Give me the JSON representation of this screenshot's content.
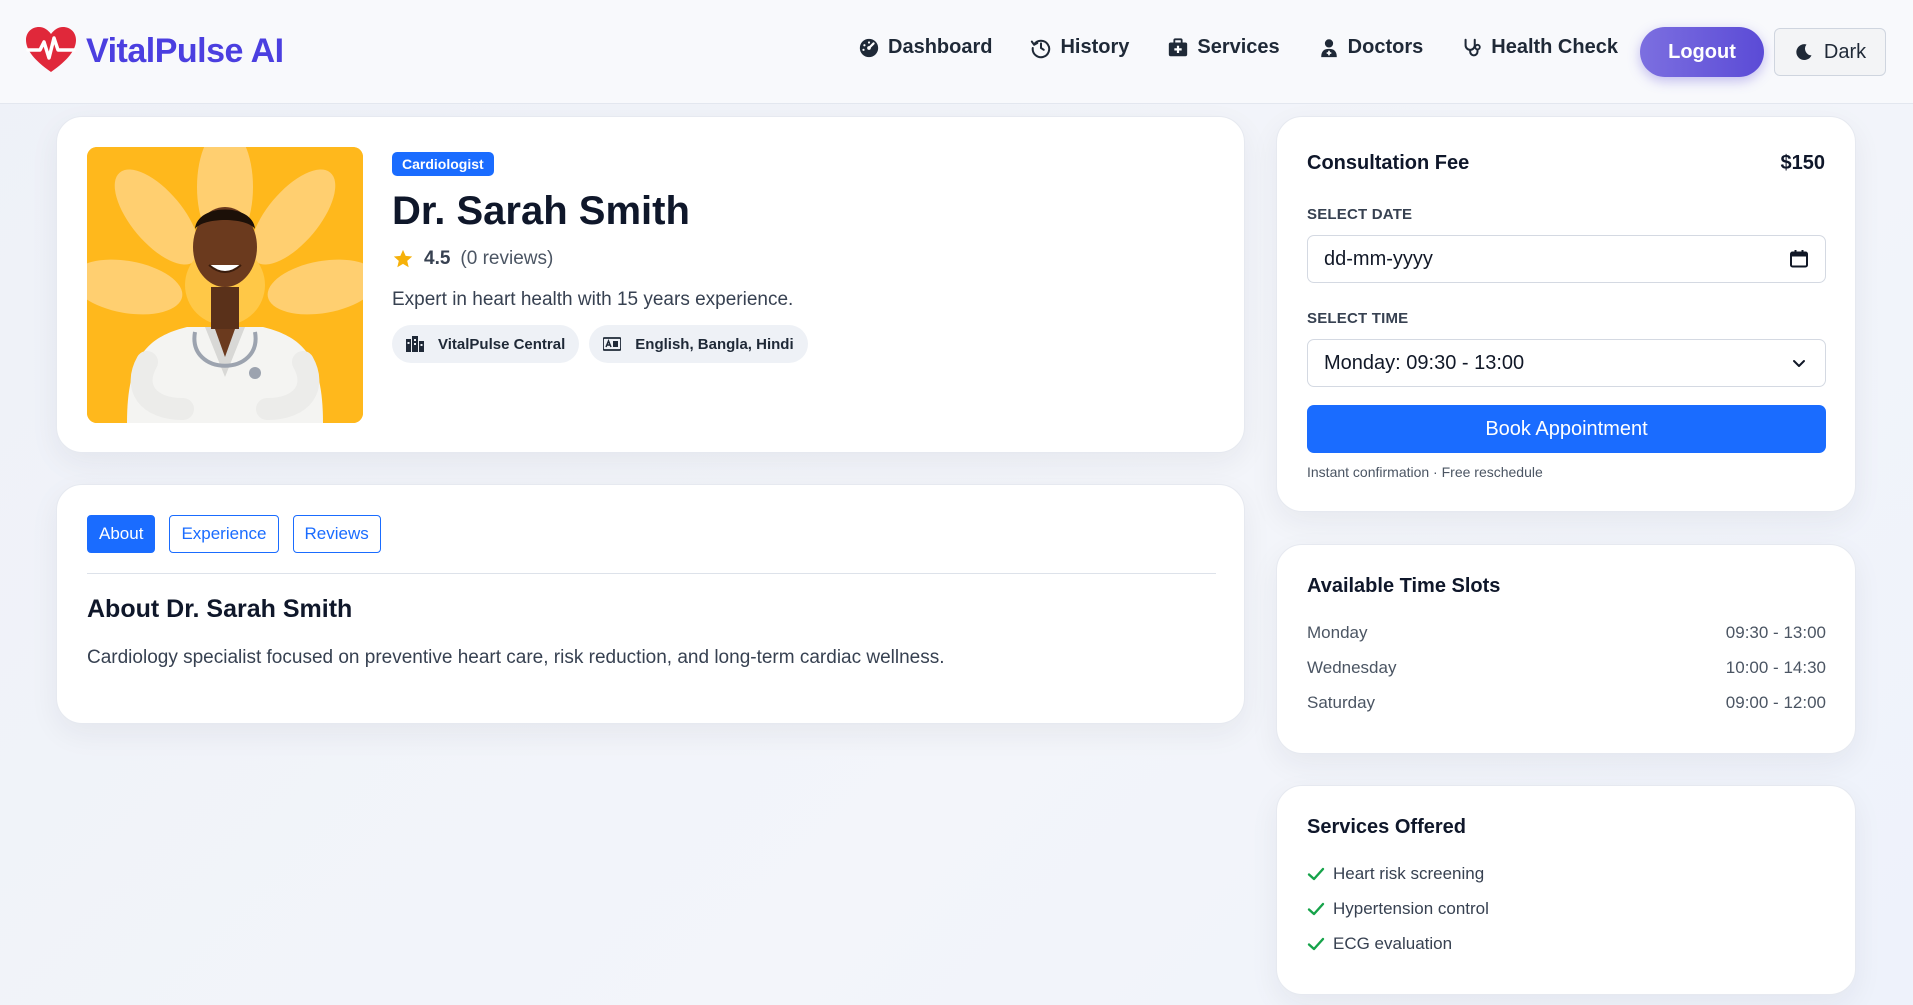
{
  "app": {
    "brand_name": "VitalPulse AI",
    "brand_color": "#4b3fe0",
    "accent": "#1a6cff"
  },
  "nav": {
    "items": [
      {
        "label": "Dashboard",
        "icon": "gauge-icon"
      },
      {
        "label": "History",
        "icon": "history-icon"
      },
      {
        "label": "Services",
        "icon": "briefcase-medical-icon"
      },
      {
        "label": "Doctors",
        "icon": "doctor-icon"
      },
      {
        "label": "Health Check",
        "icon": "stethoscope-icon"
      }
    ],
    "logout_label": "Logout",
    "theme_label": "Dark"
  },
  "profile": {
    "specialty": "Cardiologist",
    "name": "Dr. Sarah Smith",
    "rating": "4.5",
    "reviews": "(0 reviews)",
    "bio": "Expert in heart health with 15 years experience.",
    "location": "VitalPulse Central",
    "languages": "English, Bangla, Hindi"
  },
  "tabs": {
    "items": [
      "About",
      "Experience",
      "Reviews"
    ],
    "active": "About",
    "about_title": "About Dr. Sarah Smith",
    "about_text": "Cardiology specialist focused on preventive heart care, risk reduction, and long-term cardiac wellness."
  },
  "booking": {
    "fee_label": "Consultation Fee",
    "fee_value": "$150",
    "date_label": "SELECT DATE",
    "date_placeholder": "dd-mm-yyyy",
    "time_label": "SELECT TIME",
    "time_selected": "Monday: 09:30 - 13:00",
    "book_label": "Book Appointment",
    "note": "Instant confirmation · Free reschedule"
  },
  "slots": {
    "title": "Available Time Slots",
    "rows": [
      {
        "day": "Monday",
        "time": "09:30 - 13:00"
      },
      {
        "day": "Wednesday",
        "time": "10:00 - 14:30"
      },
      {
        "day": "Saturday",
        "time": "09:00 - 12:00"
      }
    ]
  },
  "services": {
    "title": "Services Offered",
    "items": [
      "Heart risk screening",
      "Hypertension control",
      "ECG evaluation"
    ]
  }
}
